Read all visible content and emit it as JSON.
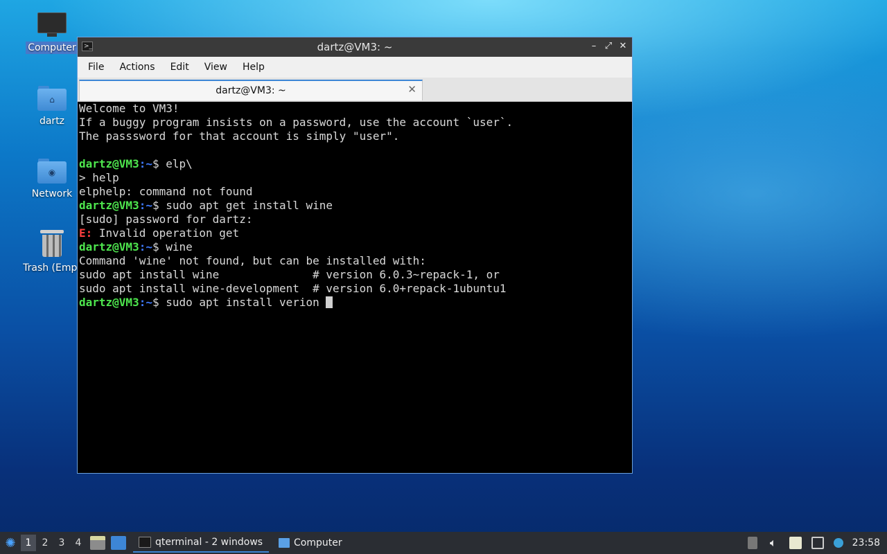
{
  "desktop": {
    "icons": [
      {
        "label": "Computer"
      },
      {
        "label": "dartz"
      },
      {
        "label": "Network"
      },
      {
        "label": "Trash (Empt"
      }
    ]
  },
  "window": {
    "title": "dartz@VM3: ~",
    "controls": {
      "minimize": "–",
      "maximize": "⤢",
      "close": "✕"
    },
    "menu": [
      "File",
      "Actions",
      "Edit",
      "View",
      "Help"
    ],
    "tab": {
      "label": "dartz@VM3: ~",
      "close": "✕"
    }
  },
  "terminal": {
    "prompt_user": "dartz@VM3",
    "prompt_path": ":~",
    "prompt_sign": "$ ",
    "welcome": [
      "Welcome to VM3!",
      "If a buggy program insists on a password, use the account `user`.",
      "The passsword for that account is simply \"user\"."
    ],
    "cmd1": "elp\\",
    "out1a": "> help",
    "out1b": "elphelp: command not found",
    "cmd2": "sudo apt get install wine",
    "out2a": "[sudo] password for dartz:",
    "out2b_prefix": "E:",
    "out2b": " Invalid operation get",
    "cmd3": "wine",
    "out3a": "Command 'wine' not found, but can be installed with:",
    "out3b": "sudo apt install wine              # version 6.0.3~repack-1, or",
    "out3c": "sudo apt install wine-development  # version 6.0+repack-1ubuntu1",
    "cmd4": "sudo apt install verion "
  },
  "taskbar": {
    "workspaces": [
      "1",
      "2",
      "3",
      "4"
    ],
    "tasks": [
      {
        "label": "qterminal - 2 windows"
      },
      {
        "label": "Computer"
      }
    ],
    "clock": "23:58"
  }
}
